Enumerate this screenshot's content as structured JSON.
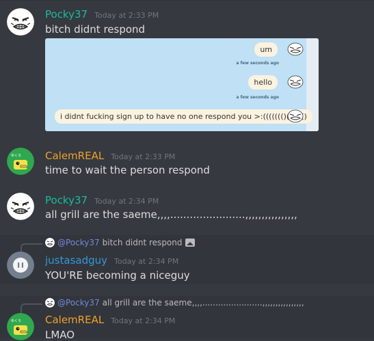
{
  "messages": {
    "m1": {
      "author": "Pocky37",
      "time": "Today at 2:33 PM",
      "text": "bitch didnt respond"
    },
    "embed": {
      "bubble1": "um",
      "bubble2": "hello",
      "bubble3": "i didnt fucking sign up to have no one respond you >:((((((()())()()",
      "stamp": "a few seconds ago"
    },
    "m2": {
      "author": "CalemREAL",
      "time": "Today at 2:33 PM",
      "text": "time to wait the person respond"
    },
    "m3": {
      "author": "Pocky37",
      "time": "Today at 2:34 PM",
      "text": "all grill are the saeme,,,,.......................,,,,,,,,,,,,,,,,"
    },
    "m4": {
      "reply_mention": "@Pocky37",
      "reply_text": "bitch didnt respond",
      "author": "justasadguy",
      "time": "Today at 2:34 PM",
      "text": "YOU'RE becoming a niceguy"
    },
    "m5": {
      "reply_mention": "@Pocky37",
      "reply_text": "all grill are the saeme,,,,.......................,,,,,,,,,,,,,,,,",
      "author": "CalemREAL",
      "time": "Today at 2:34 PM",
      "text": "LMAO"
    }
  },
  "colors": {
    "background": "#36393f",
    "pocky_name": "#1abc9c",
    "calem_name": "#f0a12a",
    "sadguy_name": "#3498db",
    "mention": "#7289da"
  }
}
